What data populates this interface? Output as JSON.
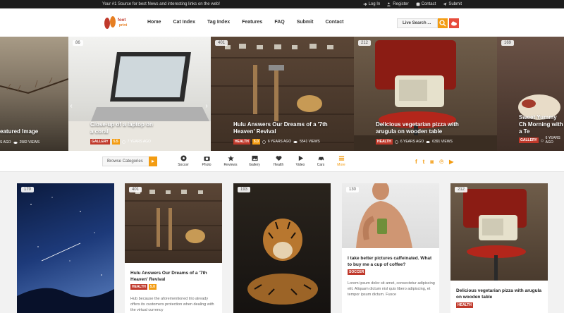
{
  "topbar": {
    "tagline": "Your #1 Source for best News and interesting links on the web!",
    "login": "Log In",
    "register": "Register",
    "contact": "Contact",
    "submit": "Submit"
  },
  "logo": {
    "text_top": "foot",
    "text_bottom": "print"
  },
  "nav": [
    "Home",
    "Cat Index",
    "Tag Index",
    "Features",
    "FAQ",
    "Submit",
    "Contact"
  ],
  "search": {
    "placeholder": "Live Search ..."
  },
  "slider": [
    {
      "count": "",
      "title": "eatured Image",
      "meta": [
        "S AGO",
        "2582 VIEWS"
      ]
    },
    {
      "count": "86",
      "title": "Close-up of a laptop on a coral",
      "badge": "GALLERY",
      "rating": "5.5",
      "age": "7 YEARS AGO"
    },
    {
      "count": "401",
      "title": "Hulu Answers Our Dreams of a '7th Heaven' Revival",
      "badge": "HEALTH",
      "rating": "5.0",
      "age": "6 YEARS AGO",
      "views": "5541 VIEWS"
    },
    {
      "count": "212",
      "title": "Delicious vegetarian pizza with arugula on wooden table",
      "badge": "HEALTH",
      "age": "6 YEARS AGO",
      "views": "6391 VIEWS"
    },
    {
      "count": "169",
      "title": "Sweet Yummy Ch Morning with a Te",
      "badge": "GALLERY",
      "age": "6 YEARS AGO"
    }
  ],
  "categories": {
    "browse_label": "Browse Categories",
    "items": [
      "Soccer",
      "Photo",
      "Reviews",
      "Gallery",
      "Health",
      "Video",
      "Cars",
      "More"
    ]
  },
  "social_icons": [
    "facebook-icon",
    "twitter-icon",
    "instagram-icon",
    "pinterest-icon",
    "youtube-icon"
  ],
  "cards": [
    {
      "count": "170",
      "title": "",
      "badge": "",
      "excerpt": ""
    },
    {
      "count": "401",
      "title": "Hulu Answers Our Dreams of a '7th Heaven' Revival",
      "badge": "HEALTH",
      "rating": "5.0",
      "excerpt": "Hub because the aforementioned trio already offers its customers protection when dealing with the virtual currency"
    },
    {
      "count": "193",
      "title": "",
      "badge": "",
      "excerpt": ""
    },
    {
      "count": "130",
      "title": "I take better pictures caffeinated. What to buy me a cup of coffee?",
      "badge": "SOCCER",
      "excerpt": "Lorem ipsum dolor sit amet, consectetur adipiscing elit. Aliquam dictum nisl quis libero adipiscing, et tempor ipsum dictum. Fusce"
    },
    {
      "count": "212",
      "title": "Delicious vegetarian pizza with arugula on wooden table",
      "badge": "HEALTH",
      "excerpt": ""
    }
  ],
  "colors": {
    "accent": "#f39c12",
    "badge": "#c0392b",
    "topbar": "#1d1d1d"
  }
}
